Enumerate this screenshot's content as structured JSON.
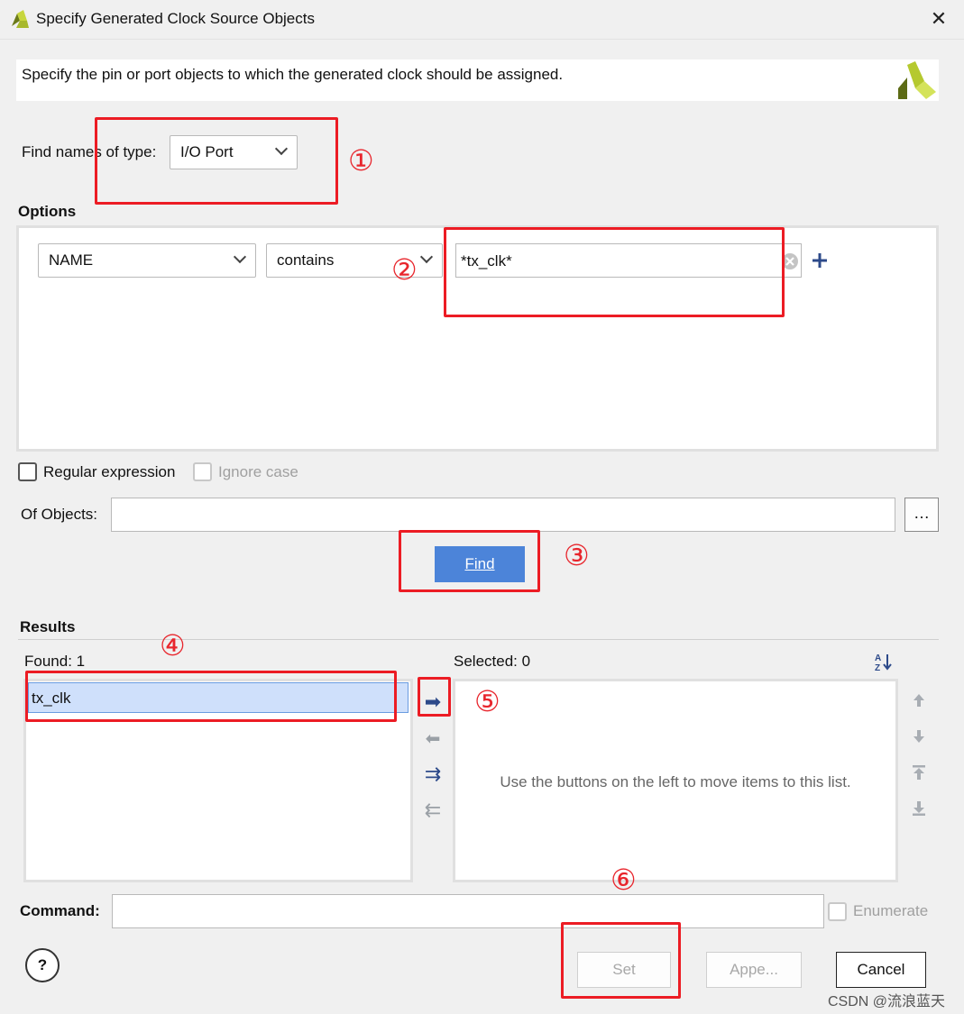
{
  "window": {
    "title": "Specify Generated Clock Source Objects",
    "description": "Specify the pin or port objects to which the generated clock should be assigned."
  },
  "find": {
    "label": "Find names of type:",
    "type_value": "I/O Port"
  },
  "options": {
    "heading": "Options",
    "property": "NAME",
    "operator": "contains",
    "pattern": "*tx_clk*",
    "regular_expression_label": "Regular expression",
    "ignore_case_label": "Ignore case",
    "of_objects_label": "Of Objects:",
    "of_objects_value": "",
    "browse_label": "…",
    "find_button": "Find"
  },
  "results": {
    "heading": "Results",
    "found_label": "Found: 1",
    "found_items": [
      "tx_clk"
    ],
    "selected_label": "Selected: 0",
    "empty_hint": "Use the buttons on the left to move items to this list."
  },
  "command": {
    "label": "Command:",
    "value": "",
    "enumerate_label": "Enumerate"
  },
  "buttons": {
    "help": "?",
    "set": "Set",
    "append": "Appe...",
    "cancel": "Cancel"
  },
  "annotations": [
    "①",
    "②",
    "③",
    "④",
    "⑤",
    "⑥"
  ],
  "watermark": "CSDN @流浪蓝天",
  "colors": {
    "accent": "#4c84d9",
    "highlight": "#ec1c24",
    "selection": "#cfe0fb"
  }
}
